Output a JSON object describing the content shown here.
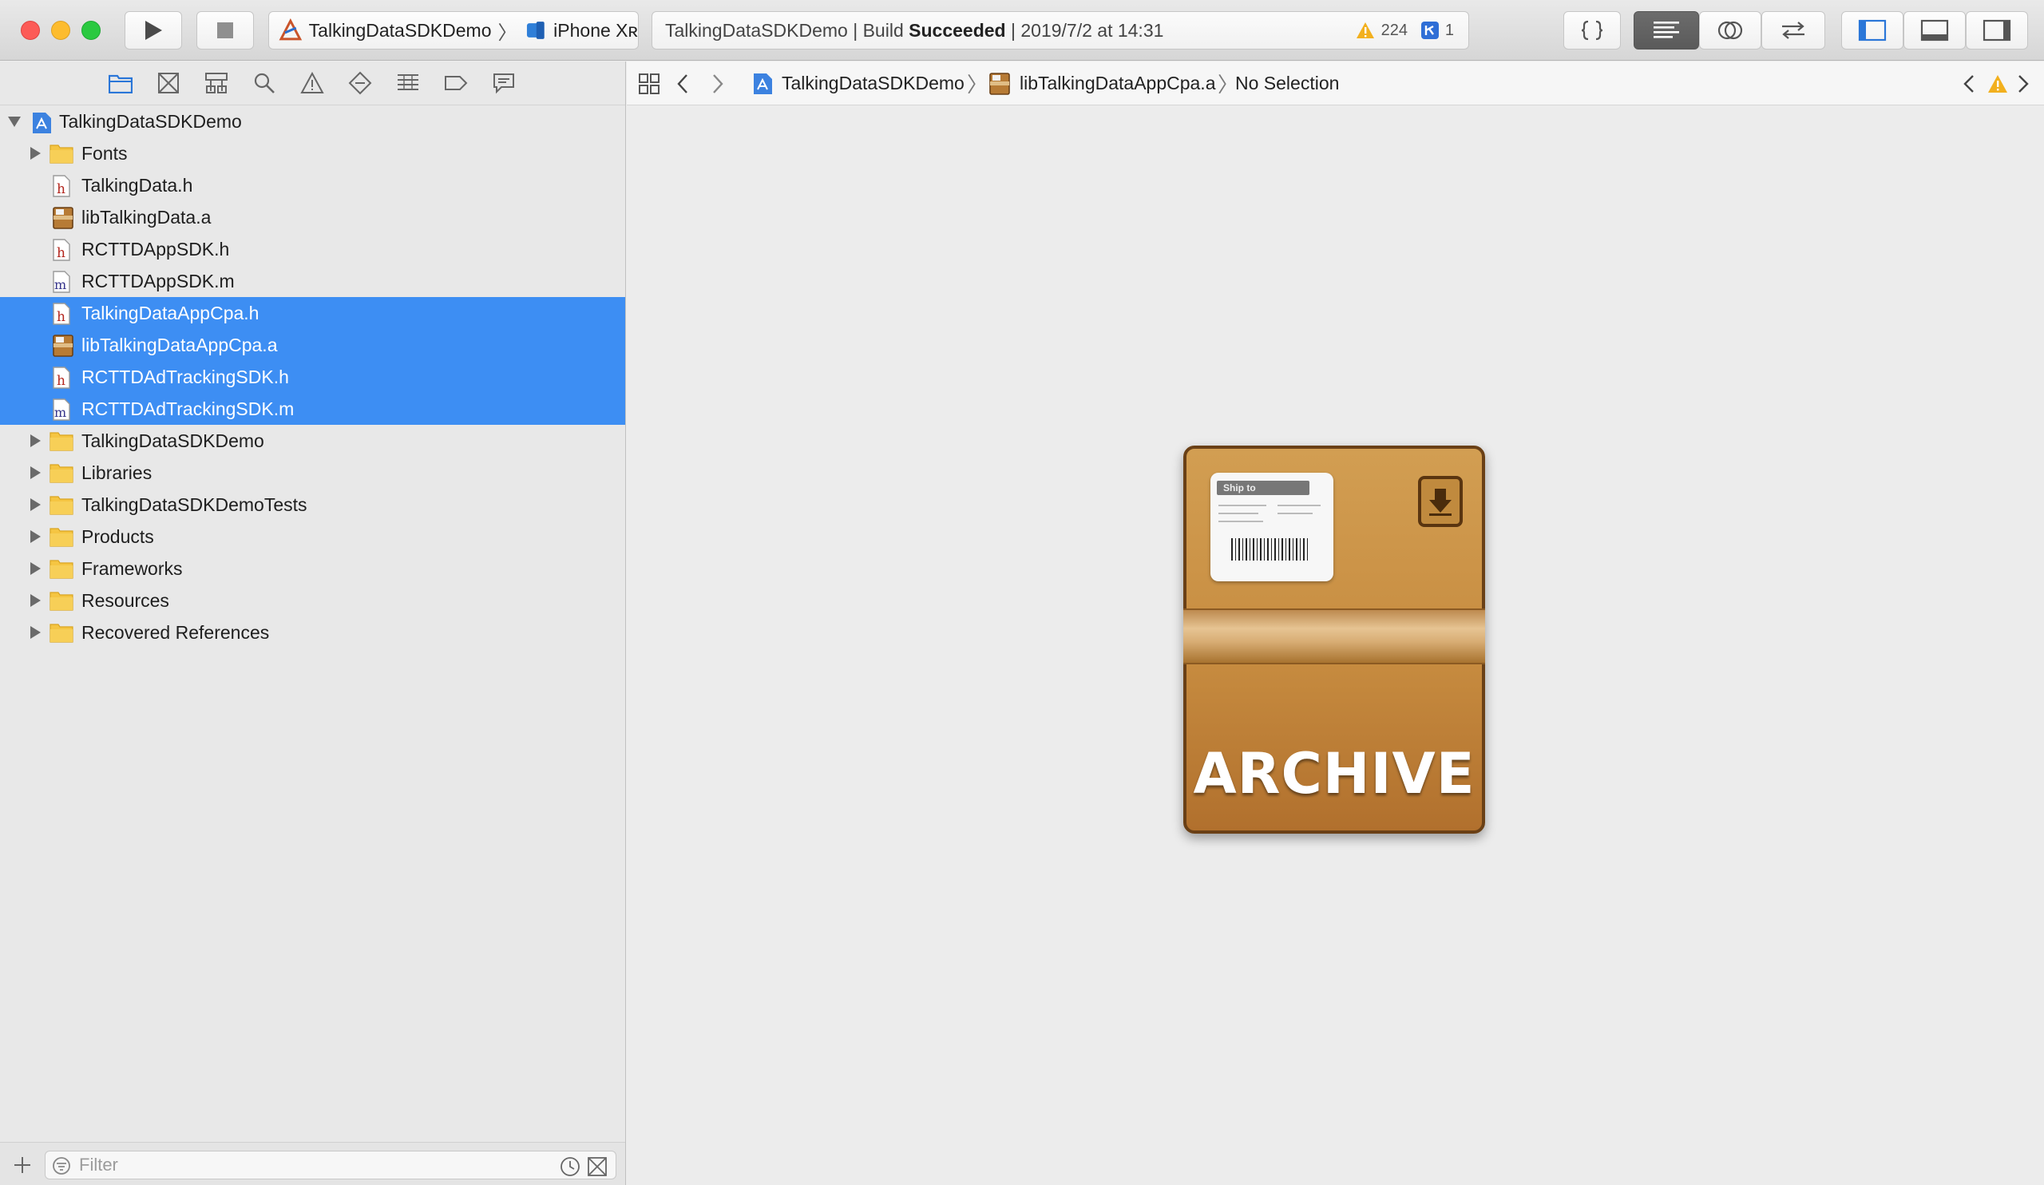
{
  "toolbar": {
    "scheme_name": "TalkingDataSDKDemo",
    "device_name": "iPhone Xʀ",
    "activity_project": "TalkingDataSDKDemo",
    "activity_build_prefix": "Build",
    "activity_build_status": "Succeeded",
    "activity_timestamp": "2019/7/2 at 14:31",
    "warning_count": "224",
    "issue_count": "1",
    "colors": {
      "warning": "#f2b01e",
      "issue": "#2f6fd6",
      "accent": "#3d8ef3"
    }
  },
  "navigator": {
    "tabs": [
      "folder-icon",
      "source-control-icon",
      "hierarchy-icon",
      "find-icon",
      "issue-icon",
      "test-icon",
      "debug-icon",
      "breakpoint-icon",
      "report-icon"
    ],
    "tree": [
      {
        "label": "TalkingDataSDKDemo",
        "type": "project",
        "level": 0,
        "expanded": true,
        "selected": false
      },
      {
        "label": "Fonts",
        "type": "folder",
        "level": 1,
        "expanded": false,
        "selected": false
      },
      {
        "label": "TalkingData.h",
        "type": "h",
        "level": 1,
        "selected": false
      },
      {
        "label": "libTalkingData.a",
        "type": "a",
        "level": 1,
        "selected": false
      },
      {
        "label": "RCTTDAppSDK.h",
        "type": "h",
        "level": 1,
        "selected": false
      },
      {
        "label": "RCTTDAppSDK.m",
        "type": "m",
        "level": 1,
        "selected": false
      },
      {
        "label": "TalkingDataAppCpa.h",
        "type": "h",
        "level": 1,
        "selected": true
      },
      {
        "label": "libTalkingDataAppCpa.a",
        "type": "a",
        "level": 1,
        "selected": true
      },
      {
        "label": "RCTTDAdTrackingSDK.h",
        "type": "h",
        "level": 1,
        "selected": true
      },
      {
        "label": "RCTTDAdTrackingSDK.m",
        "type": "m",
        "level": 1,
        "selected": true
      },
      {
        "label": "TalkingDataSDKDemo",
        "type": "folder",
        "level": 1,
        "expanded": false,
        "selected": false
      },
      {
        "label": "Libraries",
        "type": "folder",
        "level": 1,
        "expanded": false,
        "selected": false
      },
      {
        "label": "TalkingDataSDKDemoTests",
        "type": "folder",
        "level": 1,
        "expanded": false,
        "selected": false
      },
      {
        "label": "Products",
        "type": "folder",
        "level": 1,
        "expanded": false,
        "selected": false
      },
      {
        "label": "Frameworks",
        "type": "folder",
        "level": 1,
        "expanded": false,
        "selected": false
      },
      {
        "label": "Resources",
        "type": "folder",
        "level": 1,
        "expanded": false,
        "selected": false
      },
      {
        "label": "Recovered References",
        "type": "folder",
        "level": 1,
        "expanded": false,
        "selected": false
      }
    ],
    "filter_placeholder": "Filter"
  },
  "editor": {
    "jumpbar": {
      "project": "TalkingDataSDKDemo",
      "file": "libTalkingDataAppCpa.a",
      "selection": "No Selection"
    },
    "preview": {
      "type": "archive-icon",
      "archive_text": "ARCHIVE",
      "ship_label_text": "Ship to"
    }
  }
}
